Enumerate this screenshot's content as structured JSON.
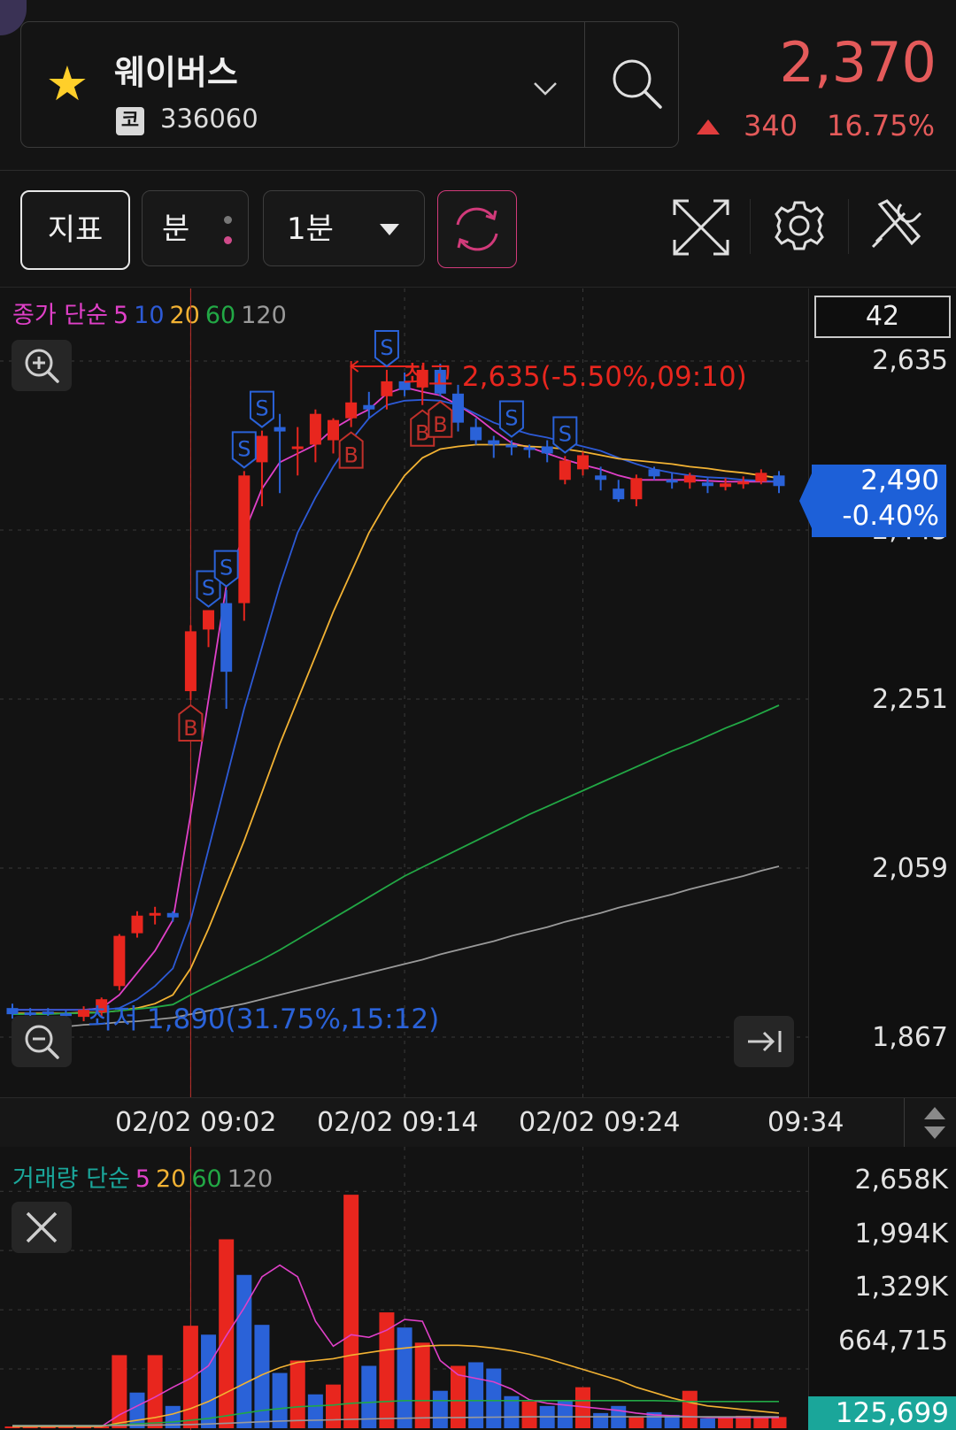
{
  "stock": {
    "name": "웨이버스",
    "market_badge": "코",
    "code": "336060",
    "price": "2,370",
    "change": "340",
    "change_pct": "16.75%",
    "change_direction": "up"
  },
  "toolbar": {
    "indicator_label": "지표",
    "period_label": "분",
    "interval_label": "1분"
  },
  "legend_price": {
    "title": "종가 단순",
    "ma": [
      {
        "label": "5",
        "color": "#e040c8"
      },
      {
        "label": "10",
        "color": "#2d5ad6"
      },
      {
        "label": "20",
        "color": "#f2b233"
      },
      {
        "label": "60",
        "color": "#22a845"
      },
      {
        "label": "120",
        "color": "#9a9a9a"
      }
    ]
  },
  "legend_volume": {
    "title": "거래량 단순",
    "ma": [
      {
        "label": "5",
        "color": "#e040c8"
      },
      {
        "label": "20",
        "color": "#f2b233"
      },
      {
        "label": "60",
        "color": "#22a845"
      },
      {
        "label": "120",
        "color": "#9a9a9a"
      }
    ]
  },
  "visible_count": "42",
  "current_tag": {
    "price": "2,490",
    "pct": "-0.40%"
  },
  "high_label": "최고 2,635(-5.50%,09:10)",
  "low_label": "최저 1,890(31.75%,15:12)",
  "last_volume": "125,699",
  "colors": {
    "up": "#e8261e",
    "down": "#2a62d8",
    "background": "#131313"
  },
  "chart_data": [
    {
      "type": "candlestick",
      "y_ticks": [
        "2,635",
        "2,443",
        "2,251",
        "2,059",
        "1,867"
      ],
      "y_tick_values": [
        2635,
        2443,
        2251,
        2059,
        1867
      ],
      "ylim": [
        1840,
        2670
      ],
      "x_tick_labels": [
        "02/02 09:02",
        "02/02 09:14",
        "02/02 09:24",
        "09:34"
      ],
      "candles": [
        {
          "o": 1900,
          "h": 1905,
          "l": 1888,
          "c": 1893,
          "dir": "down"
        },
        {
          "o": 1893,
          "h": 1900,
          "l": 1888,
          "c": 1895,
          "dir": "down"
        },
        {
          "o": 1896,
          "h": 1900,
          "l": 1890,
          "c": 1893,
          "dir": "down"
        },
        {
          "o": 1893,
          "h": 1898,
          "l": 1888,
          "c": 1894,
          "dir": "down"
        },
        {
          "o": 1890,
          "h": 1902,
          "l": 1885,
          "c": 1898,
          "dir": "up"
        },
        {
          "o": 1895,
          "h": 1912,
          "l": 1890,
          "c": 1910,
          "dir": "up"
        },
        {
          "o": 1925,
          "h": 1984,
          "l": 1920,
          "c": 1982,
          "dir": "up"
        },
        {
          "o": 1985,
          "h": 2010,
          "l": 1980,
          "c": 2005,
          "dir": "up"
        },
        {
          "o": 2005,
          "h": 2015,
          "l": 1995,
          "c": 2008,
          "dir": "up"
        },
        {
          "o": 2008,
          "h": 2010,
          "l": 1998,
          "c": 2003,
          "dir": "down"
        },
        {
          "o": 2260,
          "h": 2335,
          "l": 2250,
          "c": 2328,
          "dir": "up"
        },
        {
          "o": 2330,
          "h": 2352,
          "l": 2310,
          "c": 2352,
          "dir": "up"
        },
        {
          "o": 2360,
          "h": 2375,
          "l": 2240,
          "c": 2282,
          "dir": "down"
        },
        {
          "o": 2360,
          "h": 2510,
          "l": 2340,
          "c": 2505,
          "dir": "up"
        },
        {
          "o": 2520,
          "h": 2556,
          "l": 2470,
          "c": 2550,
          "dir": "up"
        },
        {
          "o": 2555,
          "h": 2575,
          "l": 2485,
          "c": 2560,
          "dir": "down"
        },
        {
          "o": 2535,
          "h": 2560,
          "l": 2505,
          "c": 2538,
          "dir": "up"
        },
        {
          "o": 2540,
          "h": 2580,
          "l": 2520,
          "c": 2575,
          "dir": "up"
        },
        {
          "o": 2545,
          "h": 2570,
          "l": 2530,
          "c": 2568,
          "dir": "up"
        },
        {
          "o": 2570,
          "h": 2635,
          "l": 2560,
          "c": 2588,
          "dir": "up"
        },
        {
          "o": 2585,
          "h": 2600,
          "l": 2570,
          "c": 2580,
          "dir": "down"
        },
        {
          "o": 2595,
          "h": 2625,
          "l": 2580,
          "c": 2612,
          "dir": "up"
        },
        {
          "o": 2612,
          "h": 2622,
          "l": 2595,
          "c": 2602,
          "dir": "down"
        },
        {
          "o": 2605,
          "h": 2630,
          "l": 2585,
          "c": 2625,
          "dir": "up"
        },
        {
          "o": 2625,
          "h": 2632,
          "l": 2595,
          "c": 2598,
          "dir": "down"
        },
        {
          "o": 2598,
          "h": 2608,
          "l": 2555,
          "c": 2565,
          "dir": "down"
        },
        {
          "o": 2560,
          "h": 2570,
          "l": 2540,
          "c": 2545,
          "dir": "down"
        },
        {
          "o": 2545,
          "h": 2550,
          "l": 2525,
          "c": 2540,
          "dir": "down"
        },
        {
          "o": 2540,
          "h": 2545,
          "l": 2528,
          "c": 2537,
          "dir": "down"
        },
        {
          "o": 2537,
          "h": 2540,
          "l": 2525,
          "c": 2535,
          "dir": "down"
        },
        {
          "o": 2538,
          "h": 2545,
          "l": 2520,
          "c": 2530,
          "dir": "down"
        },
        {
          "o": 2500,
          "h": 2527,
          "l": 2495,
          "c": 2522,
          "dir": "up"
        },
        {
          "o": 2512,
          "h": 2532,
          "l": 2505,
          "c": 2528,
          "dir": "up"
        },
        {
          "o": 2505,
          "h": 2515,
          "l": 2488,
          "c": 2500,
          "dir": "down"
        },
        {
          "o": 2490,
          "h": 2500,
          "l": 2475,
          "c": 2478,
          "dir": "down"
        },
        {
          "o": 2478,
          "h": 2506,
          "l": 2470,
          "c": 2502,
          "dir": "up"
        },
        {
          "o": 2512,
          "h": 2515,
          "l": 2500,
          "c": 2504,
          "dir": "down"
        },
        {
          "o": 2500,
          "h": 2508,
          "l": 2490,
          "c": 2498,
          "dir": "down"
        },
        {
          "o": 2497,
          "h": 2508,
          "l": 2490,
          "c": 2505,
          "dir": "up"
        },
        {
          "o": 2497,
          "h": 2502,
          "l": 2485,
          "c": 2493,
          "dir": "down"
        },
        {
          "o": 2496,
          "h": 2502,
          "l": 2488,
          "c": 2492,
          "dir": "up"
        },
        {
          "o": 2496,
          "h": 2504,
          "l": 2490,
          "c": 2498,
          "dir": "up"
        },
        {
          "o": 2498,
          "h": 2512,
          "l": 2495,
          "c": 2508,
          "dir": "up"
        },
        {
          "o": 2505,
          "h": 2510,
          "l": 2485,
          "c": 2493,
          "dir": "down"
        }
      ],
      "series": [
        {
          "name": "5",
          "color": "#e040c8",
          "values": [
            1898,
            1898,
            1898,
            1898,
            1898,
            1900,
            1915,
            1940,
            1965,
            2000,
            2120,
            2250,
            2380,
            2440,
            2490,
            2520,
            2530,
            2540,
            2558,
            2570,
            2580,
            2598,
            2605,
            2600,
            2596,
            2585,
            2572,
            2556,
            2542,
            2537,
            2530,
            2523,
            2517,
            2512,
            2505,
            2500,
            2500,
            2500,
            2500,
            2499,
            2498,
            2498,
            2498,
            2498
          ]
        },
        {
          "name": "10",
          "color": "#2d5ad6",
          "values": [
            1898,
            1898,
            1898,
            1898,
            1898,
            1898,
            1900,
            1910,
            1925,
            1945,
            2000,
            2080,
            2160,
            2240,
            2310,
            2380,
            2440,
            2480,
            2515,
            2545,
            2570,
            2585,
            2590,
            2591,
            2590,
            2585,
            2575,
            2565,
            2558,
            2552,
            2548,
            2543,
            2538,
            2533,
            2525,
            2518,
            2512,
            2508,
            2505,
            2503,
            2502,
            2500,
            2499,
            2498
          ]
        },
        {
          "name": "20",
          "color": "#f2b233",
          "values": [
            1894,
            1894,
            1894,
            1894,
            1895,
            1895,
            1897,
            1900,
            1905,
            1915,
            1945,
            1990,
            2040,
            2090,
            2145,
            2200,
            2250,
            2300,
            2350,
            2395,
            2440,
            2475,
            2505,
            2525,
            2535,
            2538,
            2540,
            2540,
            2540,
            2538,
            2537,
            2535,
            2532,
            2528,
            2524,
            2522,
            2520,
            2518,
            2515,
            2513,
            2510,
            2508,
            2505,
            2502
          ]
        },
        {
          "name": "60",
          "color": "#22a845",
          "values": [
            1893,
            1893,
            1893,
            1894,
            1894,
            1895,
            1897,
            1899,
            1901,
            1904,
            1915,
            1925,
            1935,
            1945,
            1955,
            1966,
            1978,
            1990,
            2002,
            2014,
            2026,
            2038,
            2050,
            2060,
            2070,
            2080,
            2090,
            2100,
            2110,
            2120,
            2129,
            2138,
            2147,
            2156,
            2165,
            2174,
            2183,
            2192,
            2200,
            2209,
            2218,
            2226,
            2235,
            2244
          ]
        },
        {
          "name": "120",
          "color": "#9a9a9a",
          "values": [
            1876,
            1877,
            1878,
            1879,
            1881,
            1882,
            1884,
            1885,
            1887,
            1889,
            1893,
            1897,
            1901,
            1905,
            1910,
            1915,
            1920,
            1925,
            1930,
            1935,
            1940,
            1945,
            1950,
            1955,
            1961,
            1966,
            1971,
            1976,
            1982,
            1987,
            1992,
            1998,
            2003,
            2008,
            2014,
            2019,
            2024,
            2029,
            2035,
            2040,
            2045,
            2050,
            2056,
            2061
          ]
        }
      ],
      "signals": [
        {
          "index": 10,
          "type": "B"
        },
        {
          "index": 11,
          "type": "S"
        },
        {
          "index": 12,
          "type": "S"
        },
        {
          "index": 13,
          "type": "S"
        },
        {
          "index": 14,
          "type": "S"
        },
        {
          "index": 19,
          "type": "B"
        },
        {
          "index": 21,
          "type": "S"
        },
        {
          "index": 23,
          "type": "B"
        },
        {
          "index": 24,
          "type": "B"
        },
        {
          "index": 28,
          "type": "S"
        },
        {
          "index": 31,
          "type": "S"
        }
      ]
    },
    {
      "type": "bar",
      "y_ticks": [
        "2,658K",
        "1,994K",
        "1,329K",
        "664,715"
      ],
      "y_tick_values": [
        2658000,
        1994000,
        1329000,
        664715
      ],
      "ylim": [
        0,
        2850000
      ],
      "values": [
        20000,
        20000,
        20000,
        20000,
        20000,
        20000,
        820000,
        400000,
        820000,
        250000,
        1150000,
        1050000,
        2120000,
        1720000,
        1160000,
        620000,
        760000,
        380000,
        490000,
        2620000,
        700000,
        1300000,
        1130000,
        960000,
        420000,
        700000,
        740000,
        670000,
        360000,
        300000,
        250000,
        310000,
        460000,
        170000,
        250000,
        120000,
        180000,
        150000,
        420000,
        110000,
        130000,
        140000,
        125699,
        125699
      ],
      "directions": [
        "up",
        "up",
        "up",
        "up",
        "up",
        "up",
        "up",
        "down",
        "up",
        "down",
        "up",
        "down",
        "up",
        "down",
        "down",
        "down",
        "up",
        "down",
        "up",
        "up",
        "down",
        "up",
        "down",
        "up",
        "down",
        "up",
        "down",
        "down",
        "down",
        "up",
        "down",
        "down",
        "up",
        "down",
        "down",
        "up",
        "down",
        "down",
        "up",
        "down",
        "up",
        "up",
        "up",
        "up"
      ],
      "series": [
        {
          "name": "5",
          "color": "#e040c8",
          "values": [
            20000,
            20000,
            20000,
            20000,
            20000,
            20000,
            150000,
            250000,
            350000,
            460000,
            560000,
            700000,
            1040000,
            1350000,
            1700000,
            1830000,
            1700000,
            1200000,
            920000,
            1050000,
            1020000,
            1100000,
            1220000,
            1200000,
            760000,
            600000,
            560000,
            520000,
            440000,
            320000,
            280000,
            260000,
            240000,
            220000,
            200000,
            170000,
            150000,
            140000,
            130000,
            120000,
            120000,
            120000,
            120000,
            120000
          ]
        },
        {
          "name": "20",
          "color": "#f2b233",
          "values": [
            20000,
            20000,
            20000,
            20000,
            20000,
            20000,
            60000,
            90000,
            120000,
            160000,
            220000,
            300000,
            400000,
            500000,
            600000,
            680000,
            740000,
            760000,
            780000,
            820000,
            850000,
            880000,
            900000,
            920000,
            930000,
            930000,
            920000,
            900000,
            870000,
            830000,
            780000,
            720000,
            660000,
            600000,
            540000,
            460000,
            400000,
            340000,
            290000,
            250000,
            230000,
            210000,
            190000,
            170000
          ]
        },
        {
          "name": "60",
          "color": "#22a845",
          "values": [
            30000,
            30000,
            30000,
            30000,
            30000,
            30000,
            40000,
            50000,
            60000,
            70000,
            90000,
            110000,
            140000,
            170000,
            200000,
            220000,
            240000,
            250000,
            260000,
            280000,
            290000,
            300000,
            310000,
            310000,
            310000,
            310000,
            310000,
            310000,
            310000,
            310000,
            310000,
            310000,
            310000,
            310000,
            310000,
            310000,
            310000,
            305000,
            300000,
            300000,
            300000,
            300000,
            300000,
            300000
          ]
        },
        {
          "name": "120",
          "color": "#9a9a9a",
          "values": [
            30000,
            30000,
            30000,
            30000,
            30000,
            30000,
            32000,
            34000,
            36000,
            38000,
            42000,
            48000,
            56000,
            64000,
            72000,
            80000,
            86000,
            90000,
            94000,
            100000,
            104000,
            108000,
            112000,
            116000,
            118000,
            120000,
            122000,
            124000,
            126000,
            128000,
            128000,
            128000,
            128000,
            128000,
            128000,
            128000,
            128000,
            128000,
            128000,
            128000,
            128000,
            128000,
            128000,
            128000
          ]
        }
      ]
    }
  ]
}
